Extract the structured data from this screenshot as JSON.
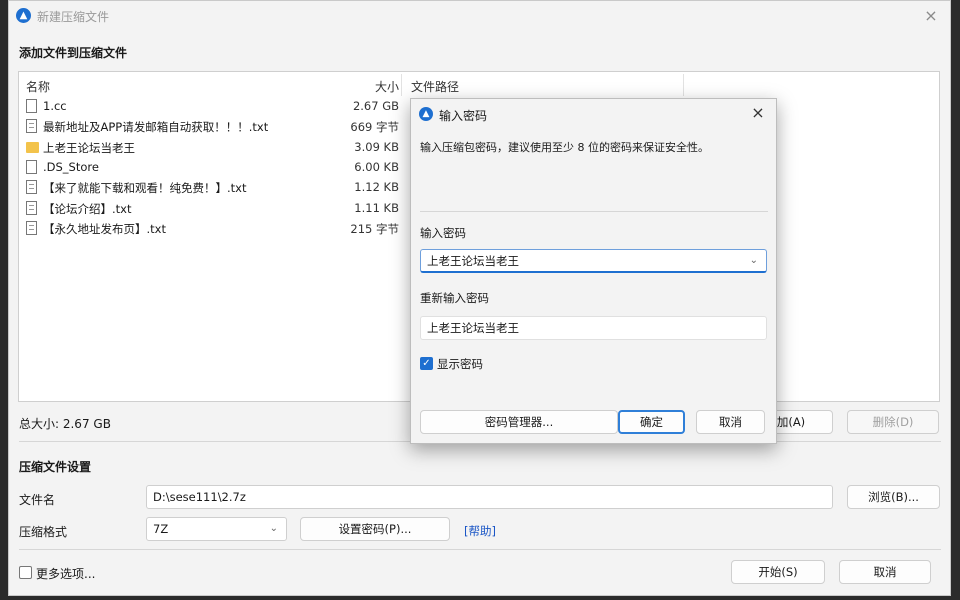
{
  "window": {
    "title": "新建压缩文件",
    "close": "×"
  },
  "files_section": {
    "heading": "添加文件到压缩文件",
    "columns": {
      "name": "名称",
      "size": "大小",
      "path": "文件路径"
    },
    "rows": [
      {
        "name": "1.cc",
        "size": "2.67 GB",
        "type": "file-icon"
      },
      {
        "name": "最新地址及APP请发邮箱自动获取！！！.txt",
        "size": "669 字节",
        "type": "text-file-icon"
      },
      {
        "name": "上老王论坛当老王",
        "size": "3.09 KB",
        "type": "folder-icon"
      },
      {
        "name": ".DS_Store",
        "size": "6.00 KB",
        "type": "file-icon"
      },
      {
        "name": "【来了就能下载和观看！纯免费！】.txt",
        "size": "1.12 KB",
        "type": "text-file-icon"
      },
      {
        "name": "【论坛介绍】.txt",
        "size": "1.11 KB",
        "type": "text-file-icon"
      },
      {
        "name": "【永久地址发布页】.txt",
        "size": "215 字节",
        "type": "text-file-icon"
      }
    ],
    "total_size": "总大小: 2.67 GB",
    "add_button": "加(A)",
    "delete_button": "删除(D)"
  },
  "settings": {
    "heading": "压缩文件设置",
    "filename_label": "文件名",
    "filename_value": "D:\\sese111\\2.7z",
    "browse_button": "浏览(B)...",
    "format_label": "压缩格式",
    "format_value": "7Z",
    "set_password_button": "设置密码(P)...",
    "help_link": "[帮助]",
    "more_options": "更多选项..."
  },
  "footer": {
    "start_button": "开始(S)",
    "cancel_button": "取消"
  },
  "password_dialog": {
    "title": "输入密码",
    "close": "×",
    "hint": "输入压缩包密码，建议使用至少 8 位的密码来保证安全性。",
    "password_label": "输入密码",
    "password_value": "上老王论坛当老王",
    "confirm_label": "重新输入密码",
    "confirm_value": "上老王论坛当老王",
    "show_password_label": "显示密码",
    "show_password_checked": true,
    "manager_button": "密码管理器...",
    "ok_button": "确定",
    "cancel_button": "取消"
  },
  "colors": {
    "accent": "#1e6fd0",
    "link": "#1a56c6",
    "window_bg": "#f3f3f3"
  }
}
